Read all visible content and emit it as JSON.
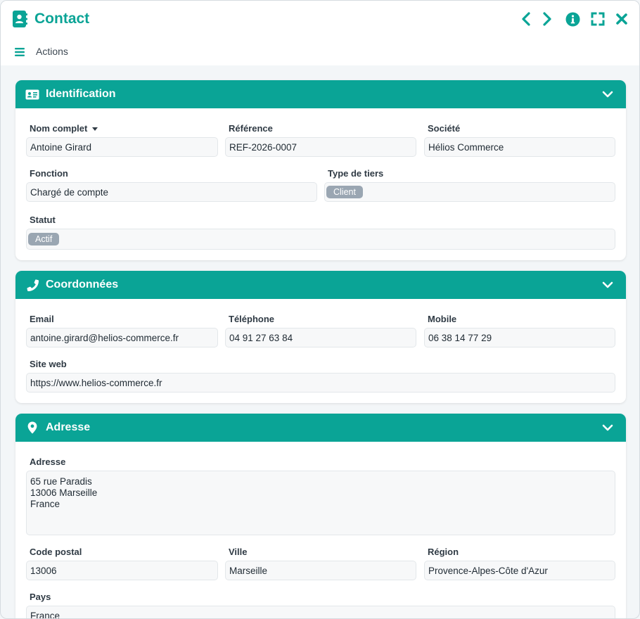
{
  "window": {
    "title": "Contact"
  },
  "toolbar": {
    "actions_label": "Actions"
  },
  "icons": {
    "title": "contact-book-icon",
    "prev": "chevron-left-icon",
    "next": "chevron-right-icon",
    "info": "info-icon",
    "fullscreen": "fullscreen-icon",
    "close": "close-icon",
    "menu": "hamburger-icon",
    "identification": "id-card-icon",
    "coordonnees": "phone-icon",
    "adresse": "map-marker-icon",
    "collapse": "chevron-down-icon"
  },
  "colors": {
    "accent": "#0aa496",
    "tag": "#9aa6b2"
  },
  "identification": {
    "title": "Identification",
    "nom_complet": {
      "label": "Nom complet",
      "value": "Antoine Girard"
    },
    "reference": {
      "label": "Référence",
      "value": "REF-2026-0007"
    },
    "societe": {
      "label": "Société",
      "value": "Hélios Commerce"
    },
    "fonction": {
      "label": "Fonction",
      "value": "Chargé de compte"
    },
    "type_tiers": {
      "label": "Type de tiers",
      "value": "Client"
    },
    "statut": {
      "label": "Statut",
      "value": "Actif"
    }
  },
  "coordonnees": {
    "title": "Coordonnées",
    "email": {
      "label": "Email",
      "value": "antoine.girard@helios-commerce.fr"
    },
    "telephone": {
      "label": "Téléphone",
      "value": "04 91 27 63 84"
    },
    "mobile": {
      "label": "Mobile",
      "value": "06 38 14 77 29"
    },
    "site_web": {
      "label": "Site web",
      "value": "https://www.helios-commerce.fr"
    }
  },
  "adresse": {
    "title": "Adresse",
    "adresse": {
      "label": "Adresse",
      "value": "65 rue Paradis\n13006 Marseille\nFrance"
    },
    "code_postal": {
      "label": "Code postal",
      "value": "13006"
    },
    "ville": {
      "label": "Ville",
      "value": "Marseille"
    },
    "region": {
      "label": "Région",
      "value": "Provence-Alpes-Côte d'Azur"
    },
    "pays": {
      "label": "Pays",
      "value": "France"
    }
  }
}
